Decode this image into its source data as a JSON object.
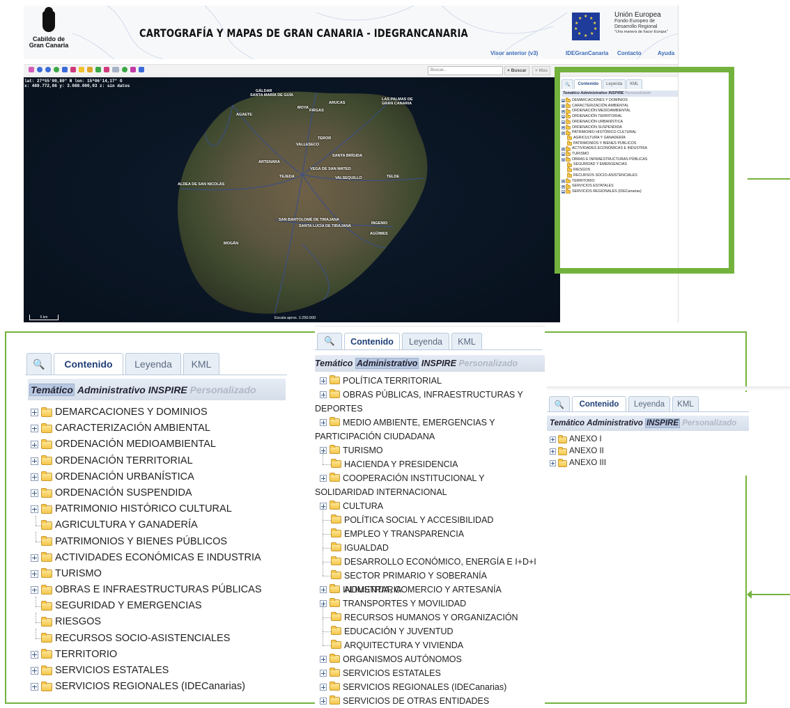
{
  "header": {
    "logo_text": "Cabildo de\nGran Canaria",
    "site_title": "CARTOGRAFÍA Y MAPAS DE GRAN CANARIA - IDEGRANCANARIA",
    "eu_title": "Unión Europea",
    "eu_sub1": "Fondo Europeo de",
    "eu_sub2": "Desarrollo Regional",
    "eu_motto": "\"Una manera de hacer Europa\"",
    "nav": [
      "Visor anterior (v3)",
      "IDEGranCanaria",
      "Contacto",
      "Ayuda"
    ]
  },
  "toolbar": {
    "search_placeholder": "Buscar...",
    "search_button": "× Buscar",
    "more_button": "× Más"
  },
  "map": {
    "coords_line1": "lat: 27º55'00,80\" N  lon: 15º06'14,17\" O",
    "coords_line2": "x: 489.772,86  y: 3.088.000,03  z: sin datos",
    "scalebar": "5 km",
    "scale": "Escala aprox. 1:250.000",
    "towns": [
      "GÁLDAR",
      "SANTA MARÍA DE GUÍA",
      "ARUCAS",
      "LAS PALMAS DE",
      "GRAN CANARIA",
      "MOYA",
      "FIRGAS",
      "AGAETE",
      "TEROR",
      "VALLESECO",
      "SANTA BRÍGIDA",
      "ARTENARA",
      "VEGA DE SAN MATEO",
      "TEJEDA",
      "VALSEQUILLO",
      "TELDE",
      "ALDEA DE SAN NICOLÁS",
      "SAN BARTOLOMÉ DE TIRAJANA",
      "SANTA LUCÍA DE TIRAJANA",
      "INGENIO",
      "AGÜIMES",
      "MOGÁN"
    ]
  },
  "panel_tabs": [
    "Contenido",
    "Leyenda",
    "KML"
  ],
  "panel_modes": {
    "tematico": "Temático",
    "administrativo": "Administrativo",
    "inspire": "INSPIRE",
    "personalizado": "Personalizado"
  },
  "tematico_tree": [
    {
      "label": "DEMARCACIONES Y DOMINIOS",
      "expand": true
    },
    {
      "label": "CARACTERIZACIÓN AMBIENTAL",
      "expand": true
    },
    {
      "label": "ORDENACIÓN MEDIOAMBIENTAL",
      "expand": true
    },
    {
      "label": "ORDENACIÓN TERRITORIAL",
      "expand": true
    },
    {
      "label": "ORDENACIÓN URBANÍSTICA",
      "expand": true
    },
    {
      "label": "ORDENACIÓN SUSPENDIDA",
      "expand": true
    },
    {
      "label": "PATRIMONIO HISTÓRICO CULTURAL",
      "expand": true
    },
    {
      "label": "AGRICULTURA Y GANADERÍA",
      "expand": false
    },
    {
      "label": "PATRIMONIOS Y BIENES PÚBLICOS",
      "expand": false
    },
    {
      "label": "ACTIVIDADES ECONÓMICAS E INDUSTRIA",
      "expand": true
    },
    {
      "label": "TURISMO",
      "expand": true
    },
    {
      "label": "OBRAS E INFRAESTRUCTURAS PÚBLICAS",
      "expand": true
    },
    {
      "label": "SEGURIDAD Y EMERGENCIAS",
      "expand": false
    },
    {
      "label": "RIESGOS",
      "expand": false
    },
    {
      "label": "RECURSOS SOCIO-ASISTENCIALES",
      "expand": false
    },
    {
      "label": "TERRITORIO",
      "expand": true
    },
    {
      "label": "SERVICIOS ESTATALES",
      "expand": true
    },
    {
      "label": "SERVICIOS REGIONALES (IDECanarias)",
      "expand": true
    }
  ],
  "administrativo_tree": [
    {
      "label": "POLÍTICA TERRITORIAL",
      "expand": true
    },
    {
      "label": "OBRAS PÚBLICAS, INFRAESTRUCTURAS Y",
      "cont": "DEPORTES",
      "expand": true
    },
    {
      "label": "MEDIO AMBIENTE, EMERGENCIAS Y",
      "cont": "PARTICIPACIÓN CIUDADANA",
      "expand": true
    },
    {
      "label": "TURISMO",
      "expand": true
    },
    {
      "label": "HACIENDA Y PRESIDENCIA",
      "expand": false
    },
    {
      "label": "COOPERACIÓN INSTITUCIONAL Y",
      "cont": "SOLIDARIDAD INTERNACIONAL",
      "expand": true
    },
    {
      "label": "CULTURA",
      "expand": true
    },
    {
      "label": "POLÍTICA SOCIAL Y ACCESIBILIDAD",
      "expand": false
    },
    {
      "label": "EMPLEO Y TRANSPARENCIA",
      "expand": false
    },
    {
      "label": "IGUALDAD",
      "expand": false
    },
    {
      "label": "DESARROLLO ECONÓMICO, ENERGÍA E I+D+I",
      "expand": false
    },
    {
      "label": "SECTOR PRIMARIO Y SOBERANÍA ALIMENTARIA",
      "expand": false
    },
    {
      "label": "INDUSTRIA, COMERCIO Y ARTESANÍA",
      "expand": true
    },
    {
      "label": "TRANSPORTES Y MOVILIDAD",
      "expand": true
    },
    {
      "label": "RECURSOS HUMANOS Y ORGANIZACIÓN",
      "expand": false
    },
    {
      "label": "EDUCACIÓN Y JUVENTUD",
      "expand": false
    },
    {
      "label": "ARQUITECTURA Y VIVIENDA",
      "expand": false
    },
    {
      "label": "ORGANISMOS AUTÓNOMOS",
      "expand": true
    },
    {
      "label": "SERVICIOS ESTATALES",
      "expand": true
    },
    {
      "label": "SERVICIOS REGIONALES (IDECanarias)",
      "expand": true
    },
    {
      "label": "SERVICIOS DE OTRAS ENTIDADES",
      "expand": true
    }
  ],
  "inspire_tree": [
    {
      "label": "ANEXO I",
      "expand": true
    },
    {
      "label": "ANEXO II",
      "expand": true
    },
    {
      "label": "ANEXO III",
      "expand": true
    }
  ],
  "colors": {
    "callout": "#74b23e",
    "link": "#3b6bb8",
    "selected_tab_text": "#1f3f77"
  }
}
